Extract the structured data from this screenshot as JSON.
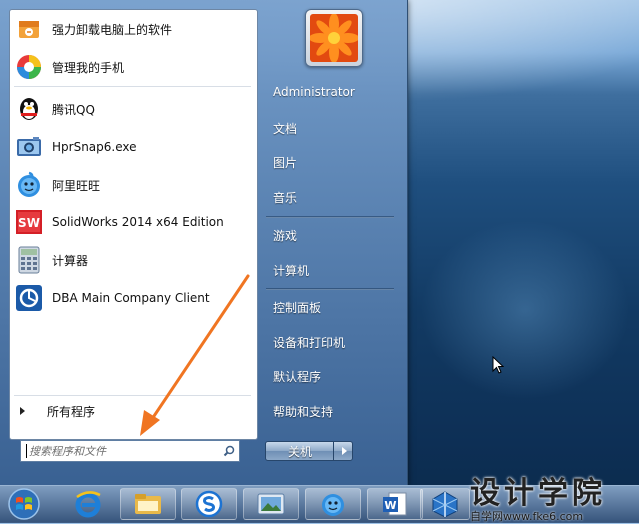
{
  "start_menu": {
    "programs": [
      {
        "label": "强力卸载电脑上的软件",
        "icon": "uninstall-box-icon"
      },
      {
        "label": "管理我的手机",
        "icon": "phone-manager-icon"
      },
      {
        "label": "腾讯QQ",
        "icon": "qq-penguin-icon"
      },
      {
        "label": "HprSnap6.exe",
        "icon": "camera-icon"
      },
      {
        "label": "阿里旺旺",
        "icon": "aliwangwang-icon"
      },
      {
        "label": "SolidWorks 2014 x64 Edition",
        "icon": "solidworks-icon"
      },
      {
        "label": "计算器",
        "icon": "calculator-icon"
      },
      {
        "label": "DBA Main Company Client",
        "icon": "dba-client-icon"
      }
    ],
    "all_programs_label": "所有程序",
    "search_placeholder": "搜索程序和文件",
    "right_items": [
      {
        "label": "Administrator"
      },
      {
        "label": "文档"
      },
      {
        "label": "图片"
      },
      {
        "label": "音乐"
      },
      {
        "label": "游戏"
      },
      {
        "label": "计算机"
      },
      {
        "label": "控制面板"
      },
      {
        "label": "设备和打印机"
      },
      {
        "label": "默认程序"
      },
      {
        "label": "帮助和支持"
      }
    ],
    "shutdown_label": "关机"
  },
  "taskbar": {
    "items": [
      "start-orb",
      "ie-icon",
      "explorer-icon",
      "sogou-icon",
      "image-viewer-icon",
      "aliwangwang-icon",
      "word-icon",
      "winrar-icon"
    ]
  },
  "watermark": {
    "title": "设计学院",
    "subtitle": "自学网www.fke6.com"
  },
  "colors": {
    "annotation_arrow": "#f07522",
    "menu_blue": "#5f88b5"
  }
}
